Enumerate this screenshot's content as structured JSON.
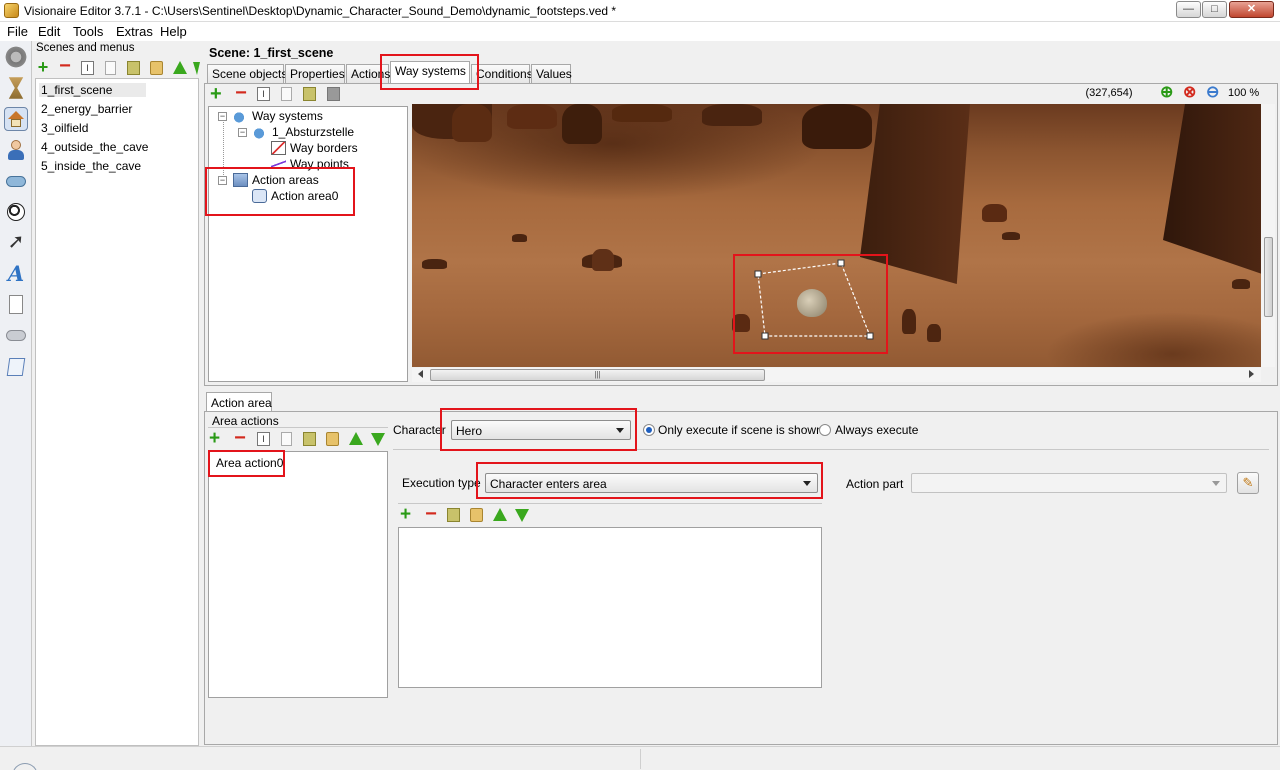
{
  "window": {
    "title": "Visionaire Editor 3.7.1 - C:\\Users\\Sentinel\\Desktop\\Dynamic_Character_Sound_Demo\\dynamic_footsteps.ved *",
    "minimize": "—",
    "maximize": "□",
    "close": "✕"
  },
  "menu": [
    "File",
    "Edit",
    "Tools",
    "Extras",
    "Help"
  ],
  "scenes_panel": {
    "header": "Scenes and menus",
    "items": [
      "1_first_scene",
      "2_energy_barrier",
      "3_oilfield",
      "4_outside_the_cave",
      "5_inside_the_cave"
    ]
  },
  "scene": {
    "title": "Scene: 1_first_scene",
    "tabs": [
      "Scene objects",
      "Properties",
      "Actions",
      "Way systems",
      "Conditions",
      "Values"
    ],
    "active_tab": "Way systems"
  },
  "tree": {
    "way_systems": "Way systems",
    "absturzstelle": "1_Absturzstelle",
    "way_borders": "Way borders",
    "way_points": "Way points",
    "action_areas": "Action areas",
    "action_area0": "Action area0"
  },
  "viewport": {
    "coords": "(327,654)",
    "zoom": "100 %",
    "scroll_grip": "|||"
  },
  "action_area": {
    "tab": "Action area",
    "area_actions_label": "Area actions",
    "area_action_item": "Area action0",
    "character_label": "Character",
    "character_value": "Hero",
    "radio_only_shown": "Only execute if scene is shown",
    "radio_always": "Always execute",
    "execution_type_label": "Execution type",
    "execution_type_value": "Character enters area",
    "action_part_label": "Action part",
    "action_part_value": ""
  },
  "colors": {
    "highlight": "#e3141b",
    "plus": "#2a9a16",
    "minus": "#d32a1e"
  }
}
